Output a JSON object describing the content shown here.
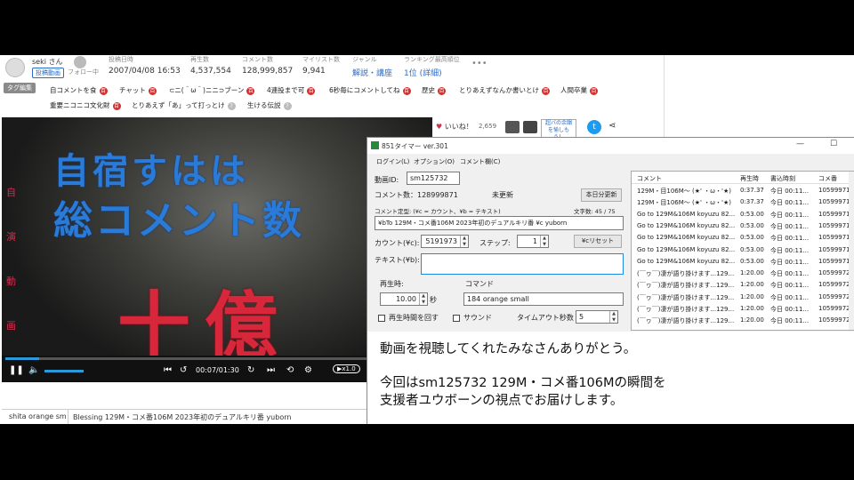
{
  "meta": {
    "user": "seki さん",
    "badge": "投稿動画",
    "follow": "フォロー中",
    "cols": [
      {
        "label": "投稿日時",
        "value": "2007/04/08 16:53"
      },
      {
        "label": "再生数",
        "value": "4,537,554"
      },
      {
        "label": "コメント数",
        "value": "128,999,857"
      },
      {
        "label": "マイリスト数",
        "value": "9,941"
      },
      {
        "label": "ジャンル",
        "value": "解説・講座"
      },
      {
        "label": "ランキング最高順位",
        "value": "1位 (詳細)"
      }
    ],
    "more": "•••"
  },
  "tags": {
    "edit": "タグ編集",
    "items": [
      "自コメントを食",
      "チャット",
      "⊂ニ(＾ω＾)ニニ⊃ブーン",
      "4連投まで可",
      "6秒毎にコメントしてね",
      "歴史",
      "とりあえずなんか書いとけ",
      "人間卒業",
      "重要ニコニコ文化財",
      "とりあえず「あ」って打っとけ",
      "生ける伝説"
    ]
  },
  "video": {
    "side_text": [
      "自",
      "演",
      "動",
      "画"
    ],
    "line1": "自宿すはは",
    "line2": "総コメント数",
    "line3": "十億",
    "time": "00:07/01:30",
    "speed": "▶x1.0",
    "progress": 0.08
  },
  "comment_bar": {
    "command": "shita orange sm",
    "text": "Blessing 129M・コメ番106M 2023年初のデュアルキリ番 yuborn"
  },
  "like": {
    "label": "いいね！",
    "count": "2,659",
    "ad": "超バの余韻を愉しもう！"
  },
  "timer": {
    "title": "851タイマー ver.301",
    "menu": [
      "ログイン(L)",
      "オプション(O)",
      "コメント欄(C)"
    ],
    "video_id_label": "動画ID:",
    "video_id": "sm125732",
    "comment_count_label": "コメント数：128999871",
    "unchanged": "未更新",
    "auto_update": "本日分更新",
    "format_label": "コメント定型: (¥c = カウント、¥b = テキスト)",
    "char_count": "文字数: 45 / 75",
    "format_value": "¥bTo 129M・コメ番106M 2023年初のデュアルキリ番 ¥c yuborn",
    "count_label": "カウント(¥c):",
    "count_value": "5191973",
    "step_label": "ステップ:",
    "step_value": "1",
    "reset": "¥cリセット",
    "text_label": "テキスト(¥b):",
    "play_time_label": "再生時:",
    "play_time": "10.00",
    "sec": "秒",
    "command_label": "コマンド",
    "command_value": "184 orange small",
    "loop": "再生時間を回す",
    "sound": "サウンド",
    "timeout_label": "タイムアウト秒数",
    "timeout": "5",
    "list_headers": [
      "コメント",
      "再生時",
      "書込時刻",
      "コメ番"
    ],
    "rows": [
      [
        "129M・目106M～ (★' ・ω・'★)",
        "0:37.37",
        "今日 00:11...",
        "105999713"
      ],
      [
        "129M・目106M～ (★' ・ω・'★)",
        "0:37.37",
        "今日 00:11...",
        "105999714"
      ],
      [
        "Go to 129M&106M koyuzu 82...",
        "0:53.00",
        "今日 00:11...",
        "105999715"
      ],
      [
        "Go to 129M&106M koyuzu 82...",
        "0:53.00",
        "今日 00:11...",
        "105999716"
      ],
      [
        "Go to 129M&106M koyuzu 82...",
        "0:53.00",
        "今日 00:11...",
        "105999717"
      ],
      [
        "Go to 129M&106M koyuzu 82...",
        "0:53.00",
        "今日 00:11...",
        "105999718"
      ],
      [
        "Go to 129M&106M koyuzu 82...",
        "0:53.00",
        "今日 00:11...",
        "105999719"
      ],
      [
        "(￣ヮ￣)凄が語り掛けます...129...",
        "1:20.00",
        "今日 00:11...",
        "105999720"
      ],
      [
        "(￣ヮ￣)凄が語り掛けます...129...",
        "1:20.00",
        "今日 00:11...",
        "105999721"
      ],
      [
        "(￣ヮ￣)凄が語り掛けます...129...",
        "1:20.00",
        "今日 00:11...",
        "105999722"
      ],
      [
        "(￣ヮ￣)凄が語り掛けます...129...",
        "1:20.00",
        "今日 00:11...",
        "105999723"
      ],
      [
        "(￣ヮ￣)凄が語り掛けます...129...",
        "1:20.00",
        "今日 00:11...",
        "105999724"
      ]
    ]
  },
  "message": {
    "line1": "動画を視聴してくれたみなさんありがとう。",
    "line2": "今回はsm125732 129M・コメ番106Mの瞬間を",
    "line3": "支援者ユウボーンの視点でお届けします。"
  }
}
